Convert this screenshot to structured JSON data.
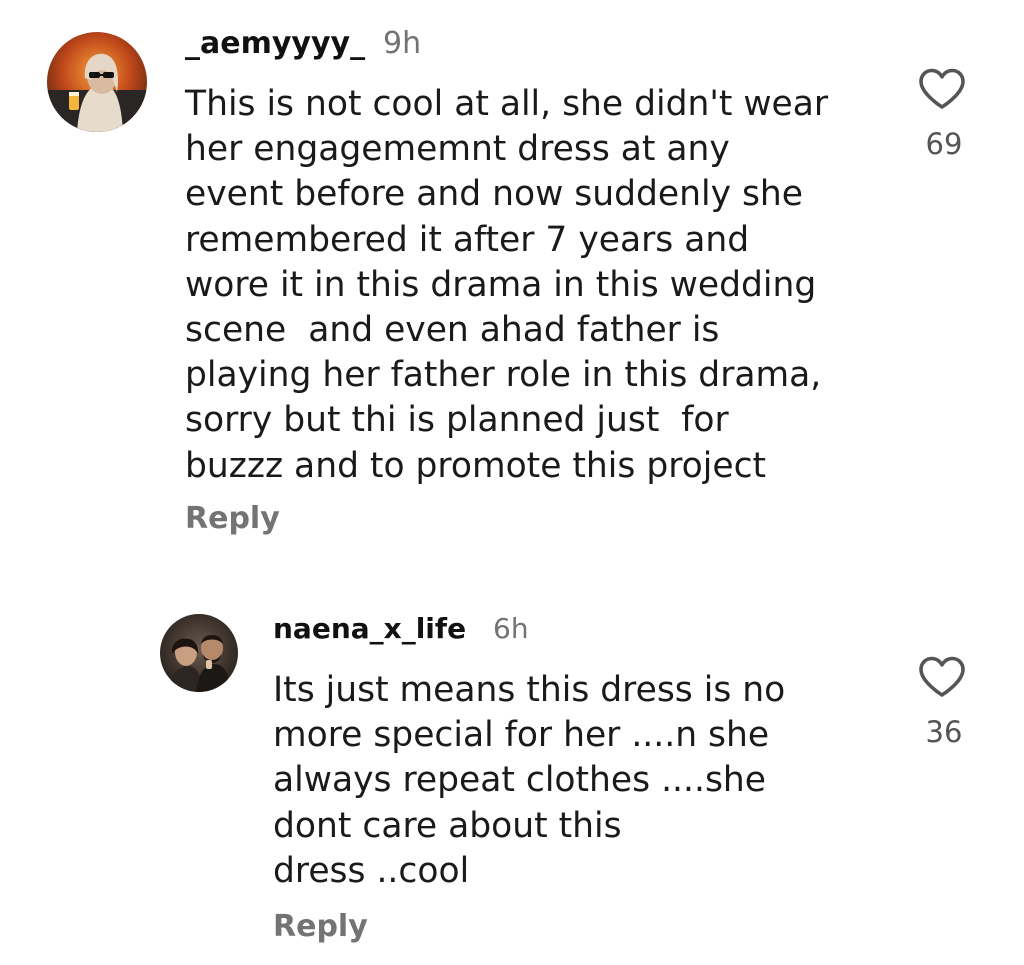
{
  "comments": [
    {
      "username": "_aemyyyy_",
      "time": "9h",
      "text_lines": [
        "This is not cool at all, she didn't wear",
        "her engagememnt dress at any",
        "event before and now suddenly she",
        "remembered it after 7 years and",
        "wore it in this drama in this wedding",
        "scene  and even ahad father is",
        "playing her father role in this drama,",
        "sorry but thi is planned just  for",
        "buzzz and to promote this project"
      ],
      "reply_label": "Reply",
      "like_icon": "heart-outline-icon",
      "like_count": "69"
    },
    {
      "username": "naena_x_life",
      "time": "6h",
      "text_lines": [
        "Its just means this dress is no",
        "more special for her ....n she",
        "always repeat clothes ....she",
        "dont care about this",
        "dress ..cool"
      ],
      "reply_label": "Reply",
      "like_icon": "heart-outline-icon",
      "like_count": "36"
    }
  ],
  "colors": {
    "background": "#ffffff",
    "text": "#1a1a1a",
    "secondary_text": "#737373",
    "icon": "#555555"
  }
}
